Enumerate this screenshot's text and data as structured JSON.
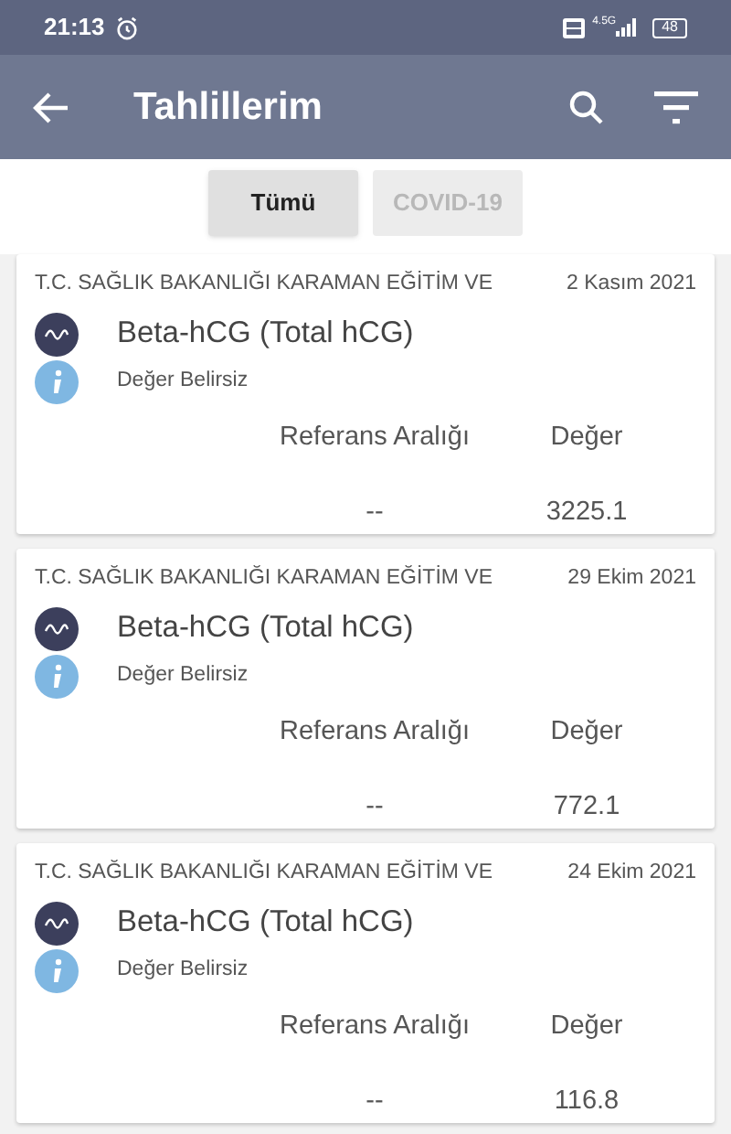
{
  "status_bar": {
    "time": "21:13",
    "network": "4.5G",
    "battery": "48"
  },
  "app_bar": {
    "title": "Tahlillerim"
  },
  "filters": [
    {
      "label": "Tümü",
      "selected": true
    },
    {
      "label": "COVID-19",
      "selected": false
    }
  ],
  "results": [
    {
      "source": "T.C. SAĞLIK BAKANLIĞI KARAMAN EĞİTİM VE",
      "date": "2 Kasım 2021",
      "test": "Beta-hCG (Total hCG)",
      "note": "Değer Belirsiz",
      "reference_header": "Referans Aralığı",
      "value_header": "Değer",
      "reference": "--",
      "value": "3225.1"
    },
    {
      "source": "T.C. SAĞLIK BAKANLIĞI KARAMAN EĞİTİM VE",
      "date": "29 Ekim 2021",
      "test": "Beta-hCG (Total hCG)",
      "note": "Değer Belirsiz",
      "reference_header": "Referans Aralığı",
      "value_header": "Değer",
      "reference": "--",
      "value": "772.1"
    },
    {
      "source": "T.C. SAĞLIK BAKANLIĞI KARAMAN EĞİTİM VE",
      "date": "24 Ekim 2021",
      "test": "Beta-hCG (Total hCG)",
      "note": "Değer Belirsiz",
      "reference_header": "Referans Aralığı",
      "value_header": "Değer",
      "reference": "--",
      "value": "116.8"
    }
  ]
}
